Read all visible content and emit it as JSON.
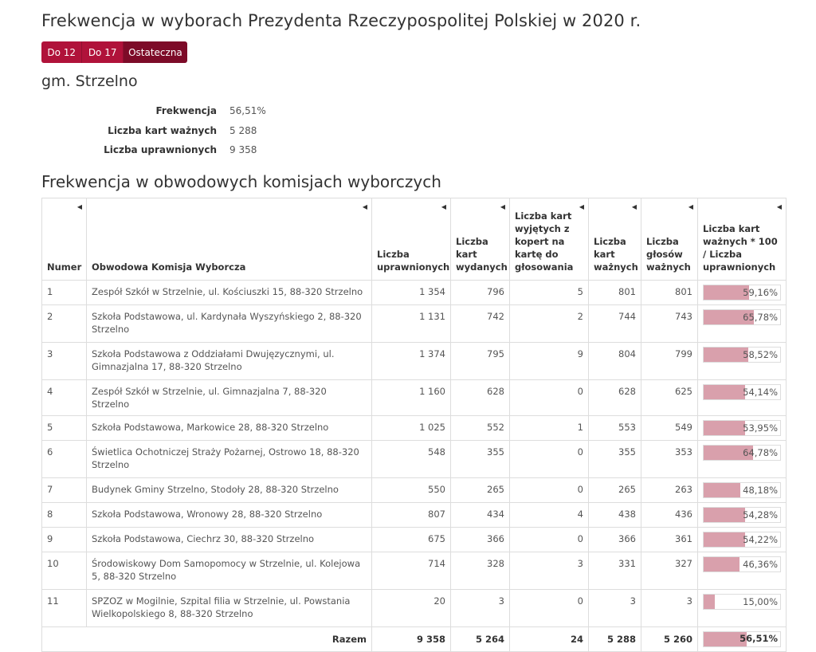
{
  "title": "Frekwencja w wyborach Prezydenta Rzeczypospolitej Polskiej w 2020 r.",
  "tabs": [
    {
      "label": "Do 12",
      "active": false
    },
    {
      "label": "Do 17",
      "active": false
    },
    {
      "label": "Ostateczna",
      "active": true
    }
  ],
  "gmina": "gm. Strzelno",
  "summary": [
    {
      "label": "Frekwencja",
      "value": "56,51%"
    },
    {
      "label": "Liczba kart ważnych",
      "value": "5 288"
    },
    {
      "label": "Liczba uprawnionych",
      "value": "9 358"
    }
  ],
  "table_title": "Frekwencja w obwodowych komisjach wyborczych",
  "columns": [
    "Numer",
    "Obwodowa Komisja Wyborcza",
    "Liczba uprawnionych",
    "Liczba kart wydanych",
    "Liczba kart wyjętych z kopert na kartę do głosowania",
    "Liczba kart ważnych",
    "Liczba głosów ważnych",
    "Liczba kart ważnych * 100 / Liczba uprawnionych"
  ],
  "rows": [
    {
      "numer": "1",
      "komisja": "Zespół Szkół w Strzelnie, ul. Kościuszki 15, 88-320 Strzelno",
      "uprawnionych": "1 354",
      "wydanych": "796",
      "wyjetych": "5",
      "waznych": "801",
      "glosow": "801",
      "frekwencja": "59,16%",
      "frekwencja_value": 59.16
    },
    {
      "numer": "2",
      "komisja": "Szkoła Podstawowa, ul. Kardynała Wyszyńskiego 2, 88-320 Strzelno",
      "uprawnionych": "1 131",
      "wydanych": "742",
      "wyjetych": "2",
      "waznych": "744",
      "glosow": "743",
      "frekwencja": "65,78%",
      "frekwencja_value": 65.78
    },
    {
      "numer": "3",
      "komisja": "Szkoła Podstawowa z Oddziałami Dwujęzycznymi, ul. Gimnazjalna 17, 88-320 Strzelno",
      "uprawnionych": "1 374",
      "wydanych": "795",
      "wyjetych": "9",
      "waznych": "804",
      "glosow": "799",
      "frekwencja": "58,52%",
      "frekwencja_value": 58.52
    },
    {
      "numer": "4",
      "komisja": "Zespół Szkół w Strzelnie, ul. Gimnazjalna 7, 88-320 Strzelno",
      "uprawnionych": "1 160",
      "wydanych": "628",
      "wyjetych": "0",
      "waznych": "628",
      "glosow": "625",
      "frekwencja": "54,14%",
      "frekwencja_value": 54.14
    },
    {
      "numer": "5",
      "komisja": "Szkoła Podstawowa, Markowice 28, 88-320 Strzelno",
      "uprawnionych": "1 025",
      "wydanych": "552",
      "wyjetych": "1",
      "waznych": "553",
      "glosow": "549",
      "frekwencja": "53,95%",
      "frekwencja_value": 53.95
    },
    {
      "numer": "6",
      "komisja": "Świetlica Ochotniczej Straży Pożarnej, Ostrowo 18, 88-320 Strzelno",
      "uprawnionych": "548",
      "wydanych": "355",
      "wyjetych": "0",
      "waznych": "355",
      "glosow": "353",
      "frekwencja": "64,78%",
      "frekwencja_value": 64.78
    },
    {
      "numer": "7",
      "komisja": "Budynek Gminy Strzelno, Stodoły 28, 88-320 Strzelno",
      "uprawnionych": "550",
      "wydanych": "265",
      "wyjetych": "0",
      "waznych": "265",
      "glosow": "263",
      "frekwencja": "48,18%",
      "frekwencja_value": 48.18
    },
    {
      "numer": "8",
      "komisja": "Szkoła Podstawowa, Wronowy 28, 88-320 Strzelno",
      "uprawnionych": "807",
      "wydanych": "434",
      "wyjetych": "4",
      "waznych": "438",
      "glosow": "436",
      "frekwencja": "54,28%",
      "frekwencja_value": 54.28
    },
    {
      "numer": "9",
      "komisja": "Szkoła Podstawowa, Ciechrz 30, 88-320 Strzelno",
      "uprawnionych": "675",
      "wydanych": "366",
      "wyjetych": "0",
      "waznych": "366",
      "glosow": "361",
      "frekwencja": "54,22%",
      "frekwencja_value": 54.22
    },
    {
      "numer": "10",
      "komisja": "Środowiskowy Dom Samopomocy w Strzelnie, ul. Kolejowa 5, 88-320 Strzelno",
      "uprawnionych": "714",
      "wydanych": "328",
      "wyjetych": "3",
      "waznych": "331",
      "glosow": "327",
      "frekwencja": "46,36%",
      "frekwencja_value": 46.36
    },
    {
      "numer": "11",
      "komisja": "SPZOZ w Mogilnie, Szpital filia w Strzelnie, ul. Powstania Wielkopolskiego 8, 88-320 Strzelno",
      "uprawnionych": "20",
      "wydanych": "3",
      "wyjetych": "0",
      "waznych": "3",
      "glosow": "3",
      "frekwencja": "15,00%",
      "frekwencja_value": 15.0
    }
  ],
  "footer": {
    "label": "Razem",
    "uprawnionych": "9 358",
    "wydanych": "5 264",
    "wyjetych": "24",
    "waznych": "5 288",
    "glosow": "5 260",
    "frekwencja": "56,51%",
    "frekwencja_value": 56.51
  },
  "colors": {
    "accent": "#b0123a",
    "accent_active": "#7d0b28",
    "bar": "#d9a0ac"
  }
}
